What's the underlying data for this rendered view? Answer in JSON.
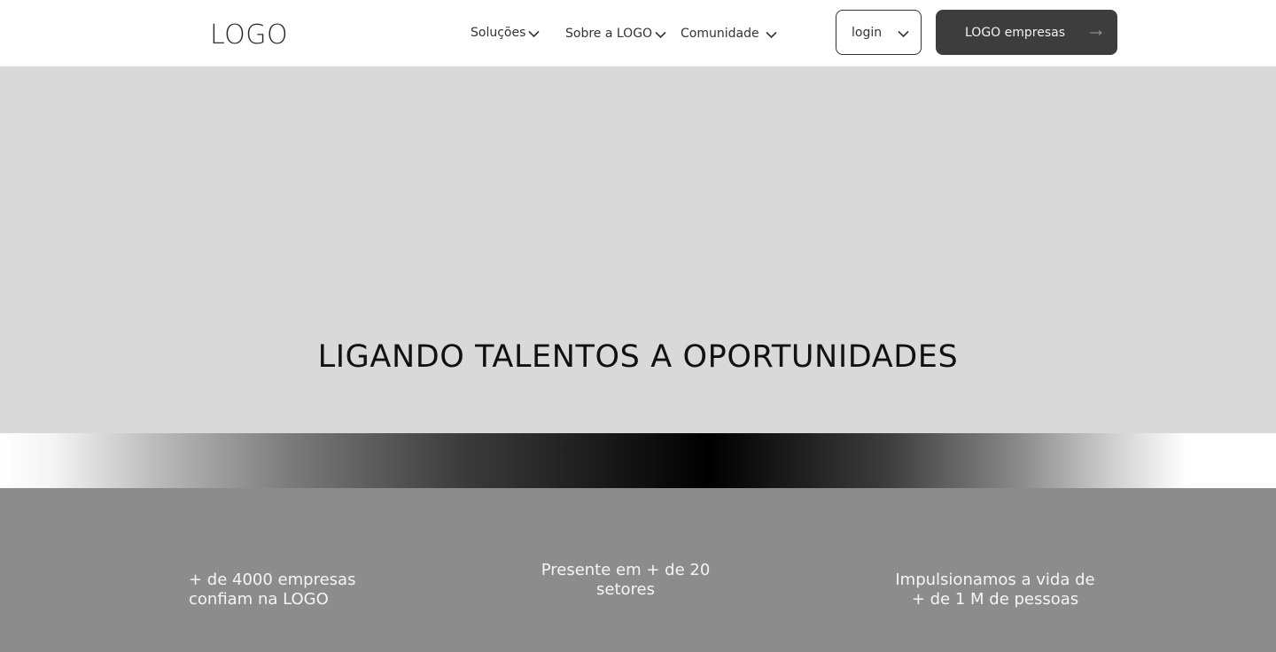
{
  "header": {
    "logo": "LOGO",
    "nav": [
      {
        "label": "Soluções"
      },
      {
        "label": "Sobre a LOGO"
      },
      {
        "label": "Comunidade"
      }
    ],
    "login_label": "login",
    "cta_label": "LOGO empresas",
    "icons": {
      "dropdown": "chevron-down-icon",
      "cta": "arrow-right-icon"
    }
  },
  "hero": {
    "title": "LIGANDO TALENTOS A OPORTUNIDADES"
  },
  "stats": [
    {
      "line1": "+ de 4000 empresas",
      "line2": "confiam na LOGO"
    },
    {
      "line1": "Presente em + de 20",
      "line2": "setores"
    },
    {
      "line1": "Impulsionamos a vida de",
      "line2": "+ de 1 M de pessoas"
    }
  ],
  "colors": {
    "hero_bg": "#d9d9d9",
    "cta_bg": "#3d3d3d",
    "stats_bg": "#8c8c8c"
  }
}
